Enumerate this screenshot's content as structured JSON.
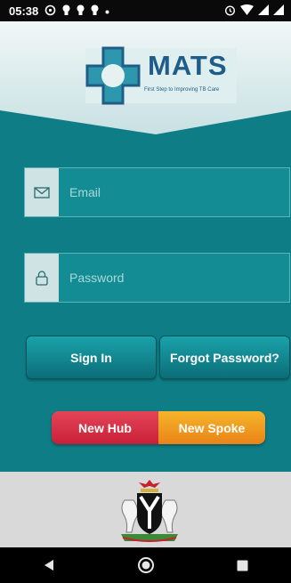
{
  "status_bar": {
    "time": "05:38"
  },
  "logo": {
    "title": "MATS",
    "tagline": "First Step to Improving TB Care"
  },
  "form": {
    "email_placeholder": "Email",
    "password_placeholder": "Password"
  },
  "buttons": {
    "sign_in": "Sign In",
    "forgot_password": "Forgot Password?",
    "new_hub": "New Hub",
    "new_spoke": "New Spoke"
  },
  "colors": {
    "background": "#0f7d86",
    "new_hub": "#d8324a",
    "new_spoke": "#f0a022",
    "logo_text": "#1f5d88"
  },
  "icons": {
    "email_field": "envelope-icon",
    "password_field": "lock-icon",
    "nav": [
      "back-icon",
      "home-icon",
      "recents-icon"
    ]
  }
}
